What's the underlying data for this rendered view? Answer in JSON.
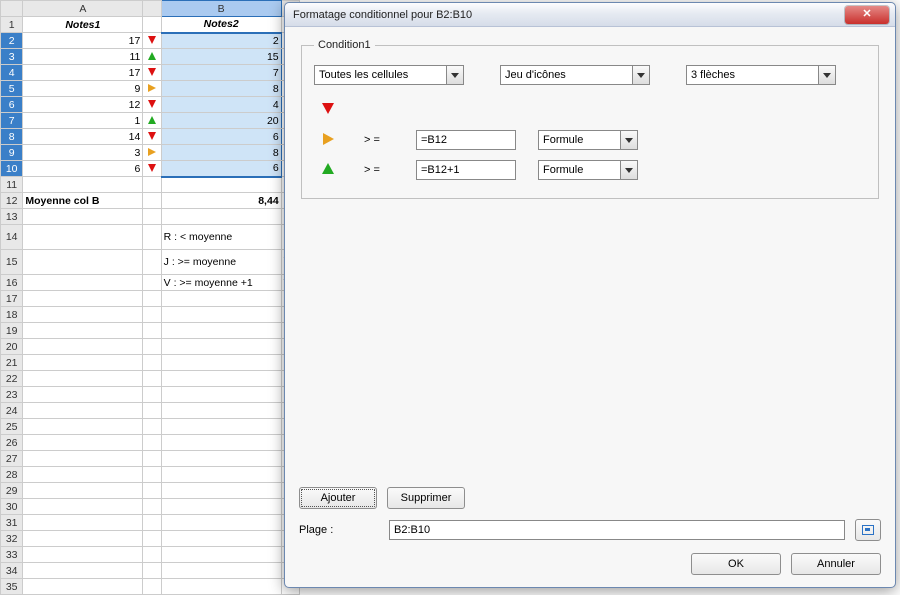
{
  "columns": {
    "A": "A",
    "B": "B"
  },
  "headers": {
    "A": "Notes1",
    "B": "Notes2"
  },
  "rows": [
    {
      "n": 2,
      "A": 17,
      "iA": "down",
      "B": 2,
      "iB": "down",
      "sel": true
    },
    {
      "n": 3,
      "A": 11,
      "iA": "up",
      "B": 15,
      "iB": "up",
      "sel": true
    },
    {
      "n": 4,
      "A": 17,
      "iA": "down",
      "B": 7,
      "iB": "down",
      "sel": true
    },
    {
      "n": 5,
      "A": 9,
      "iA": "right",
      "B": 8,
      "iB": "down",
      "sel": true
    },
    {
      "n": 6,
      "A": 12,
      "iA": "down",
      "B": 4,
      "iB": "down",
      "sel": true
    },
    {
      "n": 7,
      "A": 1,
      "iA": "up",
      "B": 20,
      "iB": "up",
      "sel": true
    },
    {
      "n": 8,
      "A": 14,
      "iA": "down",
      "B": 6,
      "iB": "down",
      "sel": true
    },
    {
      "n": 9,
      "A": 3,
      "iA": "right",
      "B": 8,
      "iB": "up",
      "sel": true
    },
    {
      "n": 10,
      "A": 6,
      "iA": "down",
      "B": 6,
      "iB": "right",
      "sel": true,
      "last": true
    }
  ],
  "avg": {
    "label": "Moyenne col B",
    "value": "8,44"
  },
  "legend": {
    "R": "R : < moyenne",
    "J": "J : >= moyenne",
    "V": "V : >= moyenne +1",
    "Rs": "R :",
    "Js": "J : >",
    "Vs": "V :"
  },
  "dialog": {
    "title": "Formatage conditionnel pour B2:B10",
    "cond_legend": "Condition1",
    "dd_scope": "Toutes les cellules",
    "dd_style": "Jeu d'icônes",
    "dd_set": "3 flèches",
    "op": "> =",
    "val1": "=B12",
    "val2": "=B12+1",
    "dd_type": "Formule",
    "add": "Ajouter",
    "del": "Supprimer",
    "plage_label": "Plage :",
    "plage": "B2:B10",
    "ok": "OK",
    "cancel": "Annuler"
  }
}
